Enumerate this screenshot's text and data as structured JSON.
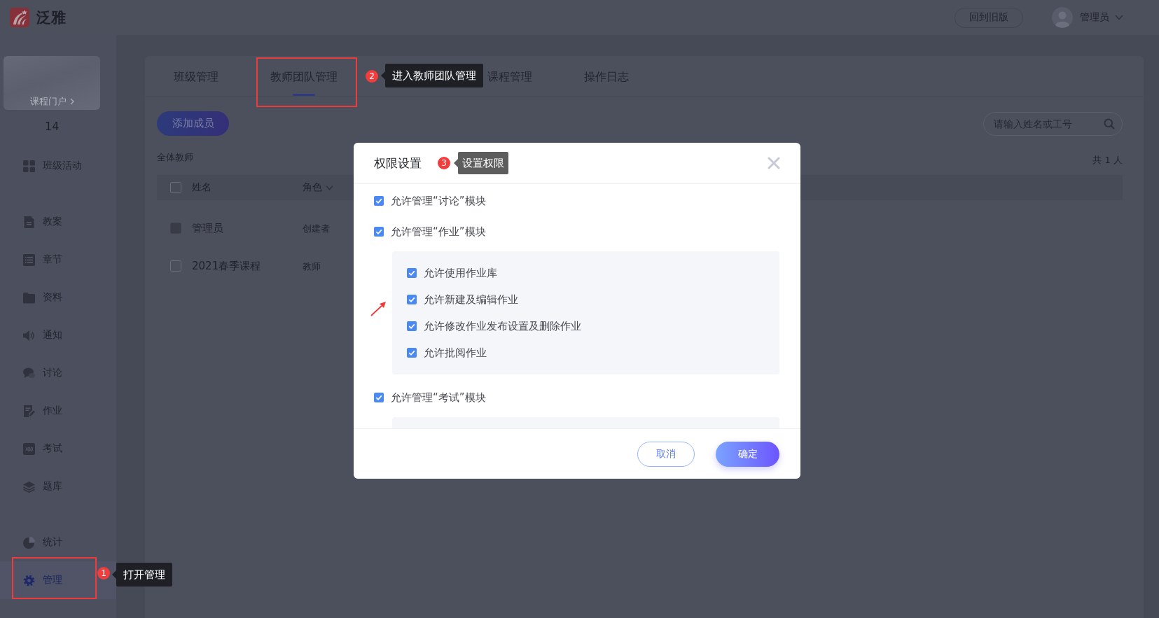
{
  "header": {
    "logo": "泛雅",
    "old_version_button": "回到旧版",
    "user_name": "管理员"
  },
  "sidebar": {
    "portal_link": "课程门户",
    "caption": "14",
    "sections": [
      {
        "items": [
          {
            "label": "班级活动",
            "selected": false,
            "highlighted": false
          }
        ]
      },
      {
        "items": [
          {
            "label": "教案",
            "selected": false,
            "highlighted": false
          },
          {
            "label": "章节",
            "selected": false,
            "highlighted": false
          },
          {
            "label": "资料",
            "selected": false,
            "highlighted": false
          },
          {
            "label": "通知",
            "selected": false,
            "highlighted": false
          },
          {
            "label": "讨论",
            "selected": false,
            "highlighted": false
          },
          {
            "label": "作业",
            "selected": false,
            "highlighted": false
          },
          {
            "label": "考试",
            "selected": false,
            "highlighted": false
          },
          {
            "label": "题库",
            "selected": false,
            "highlighted": false
          }
        ]
      },
      {
        "items": [
          {
            "label": "统计",
            "selected": false,
            "highlighted": false
          },
          {
            "label": "管理",
            "selected": true,
            "highlighted": true,
            "callout": {
              "number": "1",
              "text": "打开管理"
            }
          }
        ]
      }
    ]
  },
  "tabs": [
    {
      "label": "班级管理",
      "selected": false,
      "highlighted": false
    },
    {
      "label": "教师团队管理",
      "selected": true,
      "highlighted": true,
      "callout": {
        "number": "2",
        "text": "进入教师团队管理"
      }
    },
    {
      "label": "课程管理",
      "selected": false,
      "highlighted": false
    },
    {
      "label": "操作日志",
      "selected": false,
      "highlighted": false
    }
  ],
  "toolbar": {
    "add_button": "添加成员",
    "search": {
      "placeholder": "请输入姓名或工号"
    }
  },
  "table": {
    "title": "全体教师",
    "total": "共 1 人",
    "header_checked": false,
    "columns": [
      {
        "label": "姓名",
        "dropdown": false
      },
      {
        "label": "角色",
        "dropdown": true
      }
    ],
    "rows": [
      {
        "name": "管理员",
        "role": "创建者",
        "checked": false,
        "disabled": true
      },
      {
        "name": "2021春季课程",
        "role": "教师",
        "checked": false,
        "disabled": false
      }
    ]
  },
  "dialog": {
    "title": "权限设置",
    "callout": {
      "number": "3",
      "text": "设置权限"
    },
    "groups": [
      {
        "label": "允许管理“讨论”模块",
        "checked": true,
        "expanded": false
      },
      {
        "label": "允许管理“作业”模块",
        "checked": true,
        "expanded": true,
        "children": [
          {
            "label": "允许使用作业库",
            "checked": true
          },
          {
            "label": "允许新建及编辑作业",
            "checked": true
          },
          {
            "label": "允许修改作业发布设置及删除作业",
            "checked": true
          },
          {
            "label": "允许批阅作业",
            "checked": true
          }
        ]
      },
      {
        "label": "允许管理“考试”模块",
        "checked": true,
        "expanded": true
      }
    ],
    "buttons": [
      {
        "label": "取消",
        "kind": "secondary"
      },
      {
        "label": "确定",
        "kind": "primary"
      }
    ]
  }
}
